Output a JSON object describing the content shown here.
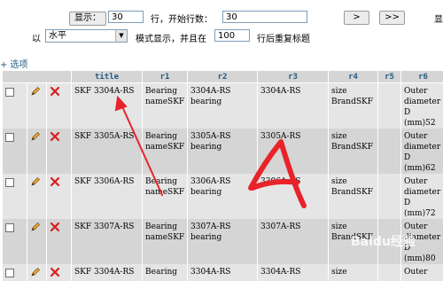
{
  "nav": {
    "show_button": "显示：",
    "rows_value": "30",
    "rows_start_label": "行，开始行数：",
    "start_value": "30",
    "next_button": ">",
    "last_button": ">>",
    "edge_text": "显",
    "mode_prefix": "以",
    "mode_selected": "水平",
    "mode_label": "模式显示，并且在",
    "repeat_value": "100",
    "repeat_label": "行后重复标题"
  },
  "options_link": "+ 选项",
  "table": {
    "columns": [
      "title",
      "r1",
      "r2",
      "r3",
      "r4",
      "r5",
      "r6"
    ],
    "rows": [
      [
        "SKF 3304A-RS",
        "Bearing\nnameSKF",
        "3304A-RS\nbearing",
        "3304A-RS",
        "size\nBrandSKF",
        "",
        "Outer\ndiameter\nD (mm)52"
      ],
      [
        "SKF 3305A-RS",
        "Bearing\nnameSKF",
        "3305A-RS\nbearing",
        "3305A-RS",
        "size\nBrandSKF",
        "",
        "Outer\ndiameter\nD (mm)62"
      ],
      [
        "SKF 3306A-RS",
        "Bearing\nnameSKF",
        "3306A-RS\nbearing",
        "3306A-RS",
        "size\nBrandSKF",
        "",
        "Outer\ndiameter\nD (mm)72"
      ],
      [
        "SKF 3307A-RS",
        "Bearing\nnameSKF",
        "3307A-RS\nbearing",
        "3307A-RS",
        "size\nBrandSKF",
        "",
        "Outer\ndiameter\nD (mm)80"
      ],
      [
        "SKF 3304A-RS",
        "Bearing",
        "3304A-RS",
        "3304A-RS",
        "size",
        "",
        "Outer"
      ]
    ]
  },
  "watermark": "Baidu经验",
  "colors": {
    "header_text": "#235a81",
    "annotation": "#e8232a",
    "row_odd": "#e5e5e5",
    "row_even": "#d5d5d5"
  },
  "icons": [
    "checkbox",
    "pencil-icon",
    "delete-x-icon"
  ]
}
